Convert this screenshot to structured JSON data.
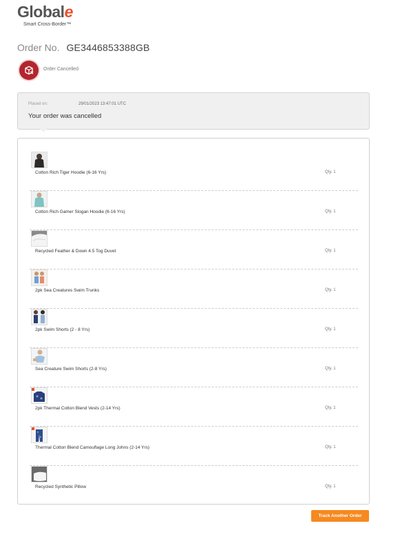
{
  "brand": {
    "logo_text": "Global",
    "logo_suffix": "e",
    "tagline": "Smart Cross-Border™",
    "accent_color": "#e8502a"
  },
  "order": {
    "label": "Order No.",
    "number": "GE3446853388GB",
    "status": "Order Cancelled",
    "status_icon": "cancelled-package-icon",
    "status_color": "#b3252d",
    "placed_label": "Placed on:",
    "placed_date": "29/01/2023 13:47:01 UTC",
    "message": "Your order was cancelled"
  },
  "items": [
    {
      "name": "Cotton Rich Tiger Hoodie (6-16 Yrs)",
      "qty": "Qty. 1",
      "thumbnail": "dark-hoodie-product-image"
    },
    {
      "name": "Cotton Rich Gamer Slogan Hoodie (6-16 Yrs)",
      "qty": "Qty. 1",
      "thumbnail": "teal-hoodie-product-image"
    },
    {
      "name": "Recycled Feather & Down 4.5 Tog Duvet",
      "qty": "Qty. 1",
      "thumbnail": "white-duvet-product-image"
    },
    {
      "name": "2pk Sea Creatures Swim Trunks",
      "qty": "Qty. 1",
      "thumbnail": "swim-trunks-product-image"
    },
    {
      "name": "2pk Swim Shorts (2 - 8 Yrs)",
      "qty": "Qty. 1",
      "thumbnail": "swim-shorts-product-image"
    },
    {
      "name": "Sea Creature Swim Shorts (2-8 Yrs)",
      "qty": "Qty. 1",
      "thumbnail": "child-swim-shorts-product-image"
    },
    {
      "name": "2pk Thermal Cotton Blend Vests (2-14 Yrs)",
      "qty": "Qty. 1",
      "thumbnail": "thermal-vests-product-image"
    },
    {
      "name": "Thermal Cotton Blend Camouflage Long Johns (2-14 Yrs)",
      "qty": "Qty. 1",
      "thumbnail": "camouflage-long-johns-product-image"
    },
    {
      "name": "Recycled Synthetic Pillow",
      "qty": "Qty. 1",
      "thumbnail": "pillow-product-image"
    }
  ],
  "actions": {
    "track_another_label": "Track Another Order",
    "button_color": "#f6891f"
  }
}
